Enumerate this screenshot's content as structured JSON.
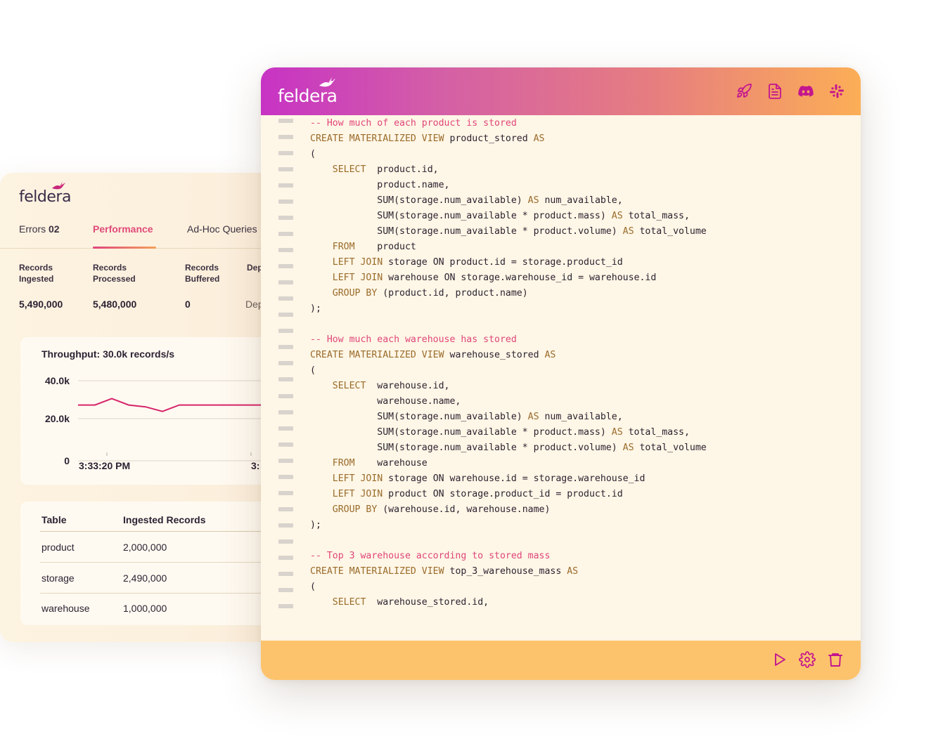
{
  "dashboard": {
    "logo_text": "feldera",
    "tabs": {
      "errors_label": "Errors",
      "errors_count": "02",
      "performance": "Performance",
      "adhoc": "Ad-Hoc Queries"
    },
    "metrics": [
      {
        "label": "Records Ingested",
        "value": "5,490,000"
      },
      {
        "label": "Records Processed",
        "value": "5,480,000"
      },
      {
        "label": "Records Buffered",
        "value": "0"
      },
      {
        "label": "Dep",
        "value": "Dep"
      }
    ],
    "throughput": {
      "title": "Throughput: 30.0k records/s",
      "y_ticks": [
        "40.0k",
        "20.0k",
        "0"
      ],
      "x_ticks": [
        "3:33:20 PM",
        "3:"
      ]
    },
    "table": {
      "headers": [
        "Table",
        "Ingested Records"
      ],
      "rows": [
        [
          "product",
          "2,000,000"
        ],
        [
          "storage",
          "2,490,000"
        ],
        [
          "warehouse",
          "1,000,000"
        ]
      ]
    }
  },
  "chart_data": {
    "type": "line",
    "title": "Throughput: 30.0k records/s",
    "ylim": [
      0,
      40000
    ],
    "y_ticks": [
      0,
      20000,
      40000
    ],
    "x_tick_labels": [
      "3:33:20 PM",
      "3:"
    ],
    "series": [
      {
        "values": [
          29000,
          29000,
          32500,
          29000,
          28000,
          25500,
          29000,
          29000,
          29000,
          29000,
          29000,
          29000,
          29000,
          29000
        ]
      }
    ],
    "grid": true,
    "line_color": "#d6246b"
  },
  "editor": {
    "logo_text": "feldera",
    "header_icons": [
      "rocket-icon",
      "document-icon",
      "discord-icon",
      "slack-icon"
    ],
    "footer_icons": [
      "play-icon",
      "gear-icon",
      "trash-icon"
    ],
    "code_lines": [
      "-- How much of each product is stored",
      "CREATE MATERIALIZED VIEW product_stored AS",
      "(",
      "    SELECT  product.id,",
      "            product.name,",
      "            SUM(storage.num_available) AS num_available,",
      "            SUM(storage.num_available * product.mass) AS total_mass,",
      "            SUM(storage.num_available * product.volume) AS total_volume",
      "    FROM    product",
      "    LEFT JOIN storage ON product.id = storage.product_id",
      "    LEFT JOIN warehouse ON storage.warehouse_id = warehouse.id",
      "    GROUP BY (product.id, product.name)",
      ");",
      "",
      "-- How much each warehouse has stored",
      "CREATE MATERIALIZED VIEW warehouse_stored AS",
      "(",
      "    SELECT  warehouse.id,",
      "            warehouse.name,",
      "            SUM(storage.num_available) AS num_available,",
      "            SUM(storage.num_available * product.mass) AS total_mass,",
      "            SUM(storage.num_available * product.volume) AS total_volume",
      "    FROM    warehouse",
      "    LEFT JOIN storage ON warehouse.id = storage.warehouse_id",
      "    LEFT JOIN product ON storage.product_id = product.id",
      "    GROUP BY (warehouse.id, warehouse.name)",
      ");",
      "",
      "-- Top 3 warehouse according to stored mass",
      "CREATE MATERIALIZED VIEW top_3_warehouse_mass AS",
      "(",
      "    SELECT  warehouse_stored.id,"
    ]
  }
}
